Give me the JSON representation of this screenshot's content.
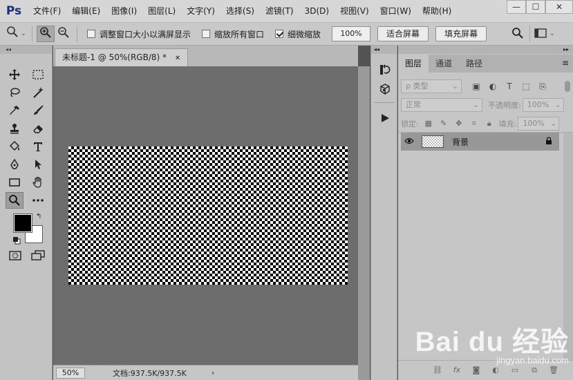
{
  "app": {
    "logo": "Ps"
  },
  "menu": [
    "文件(F)",
    "编辑(E)",
    "图像(I)",
    "图层(L)",
    "文字(Y)",
    "选择(S)",
    "滤镜(T)",
    "3D(D)",
    "视图(V)",
    "窗口(W)",
    "帮助(H)"
  ],
  "window_controls": {
    "minimize": "—",
    "maximize": "☐",
    "close": "✕"
  },
  "options": {
    "resize_windows_label": "调整窗口大小以满屏显示",
    "resize_windows_checked": false,
    "zoom_all_label": "缩放所有窗口",
    "zoom_all_checked": false,
    "scrubby_zoom_label": "细微缩放",
    "scrubby_zoom_checked": true,
    "zoom_value": "100%",
    "fit_screen_label": "适合屏幕",
    "fill_screen_label": "填充屏幕"
  },
  "document": {
    "tab_title": "未标题-1 @ 50%(RGB/8) *",
    "tab_close": "✕",
    "status_zoom": "50%",
    "status_info": "文档:937.5K/937.5K",
    "status_arrow": "›"
  },
  "layers_panel": {
    "tabs": [
      "图层",
      "通道",
      "路径"
    ],
    "filter_placeholder": "ρ 类型",
    "blend_mode": "正常",
    "opacity_label": "不透明度:",
    "opacity_value": "100%",
    "lock_label": "锁定:",
    "fill_label": "填充:",
    "fill_value": "100%",
    "layers": [
      {
        "name": "背景",
        "visible": true,
        "locked": true
      }
    ]
  },
  "watermark": {
    "logo": "Bai du 经验",
    "url": "jingyan.baidu.com"
  },
  "colors": {
    "foreground": "#000000",
    "background": "#ffffff"
  }
}
